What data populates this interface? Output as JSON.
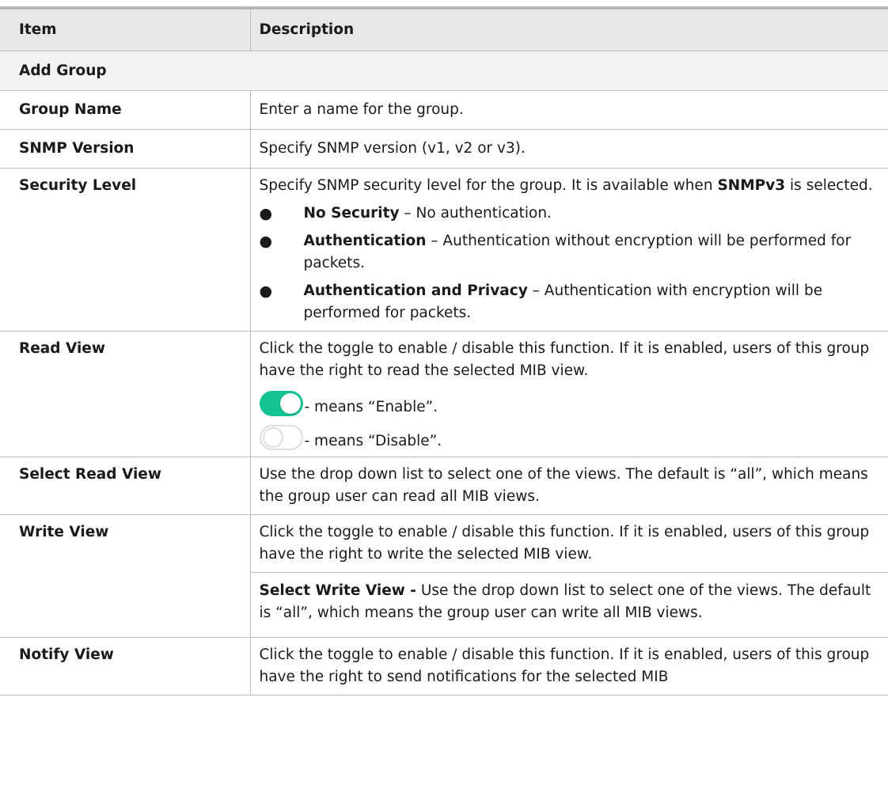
{
  "header": {
    "item": "Item",
    "description": "Description"
  },
  "section": {
    "title": "Add Group"
  },
  "rows": {
    "group_name": {
      "label": "Group Name",
      "desc": "Enter a name for the group."
    },
    "snmp_version": {
      "label": "SNMP Version",
      "desc": "Specify SNMP version (v1, v2 or v3)."
    },
    "security_level": {
      "label": "Security Level",
      "desc_a": "Specify SNMP security level for the group. It is available when",
      "desc_bold": "SNMPv3",
      "desc_b": " is selected.",
      "bullet_glyph": "●",
      "bullets": [
        {
          "term": "No Security",
          "text": " – No authentication."
        },
        {
          "term": "Authentication",
          "text": " – Authentication without encryption will be performed for packets."
        },
        {
          "term": "Authentication and Privacy",
          "text": " – Authentication with encryption will be performed for packets."
        }
      ]
    },
    "read_view": {
      "label": "Read View",
      "desc": "Click the toggle to enable / disable this function. If it is enabled, users of this group have the right to read the selected MIB view.",
      "enable_text": "- means “Enable”.",
      "disable_text": "- means “Disable”."
    },
    "select_read_view": {
      "label": "Select Read View",
      "desc": "Use the drop down list to select one of the views. The default is “all”, which means the group user can read all MIB views."
    },
    "write_view": {
      "label": "Write View",
      "desc": "Click the toggle to enable / disable this function. If it is enabled, users of this group have the right to write the selected MIB view.",
      "sub_bold": "Select Write View -",
      "sub_text": " Use the drop down list to select one of the views. The default is “all”, which means the group user can write all MIB views."
    },
    "notify_view": {
      "label": "Notify View",
      "desc": "Click the toggle to enable / disable this function. If it is enabled, users of this group have the right to send notifications for the selected MIB"
    }
  },
  "colors": {
    "toggle_on": "#13c392",
    "toggle_off_border": "#dedede",
    "header_bg": "#e7e7e7"
  }
}
